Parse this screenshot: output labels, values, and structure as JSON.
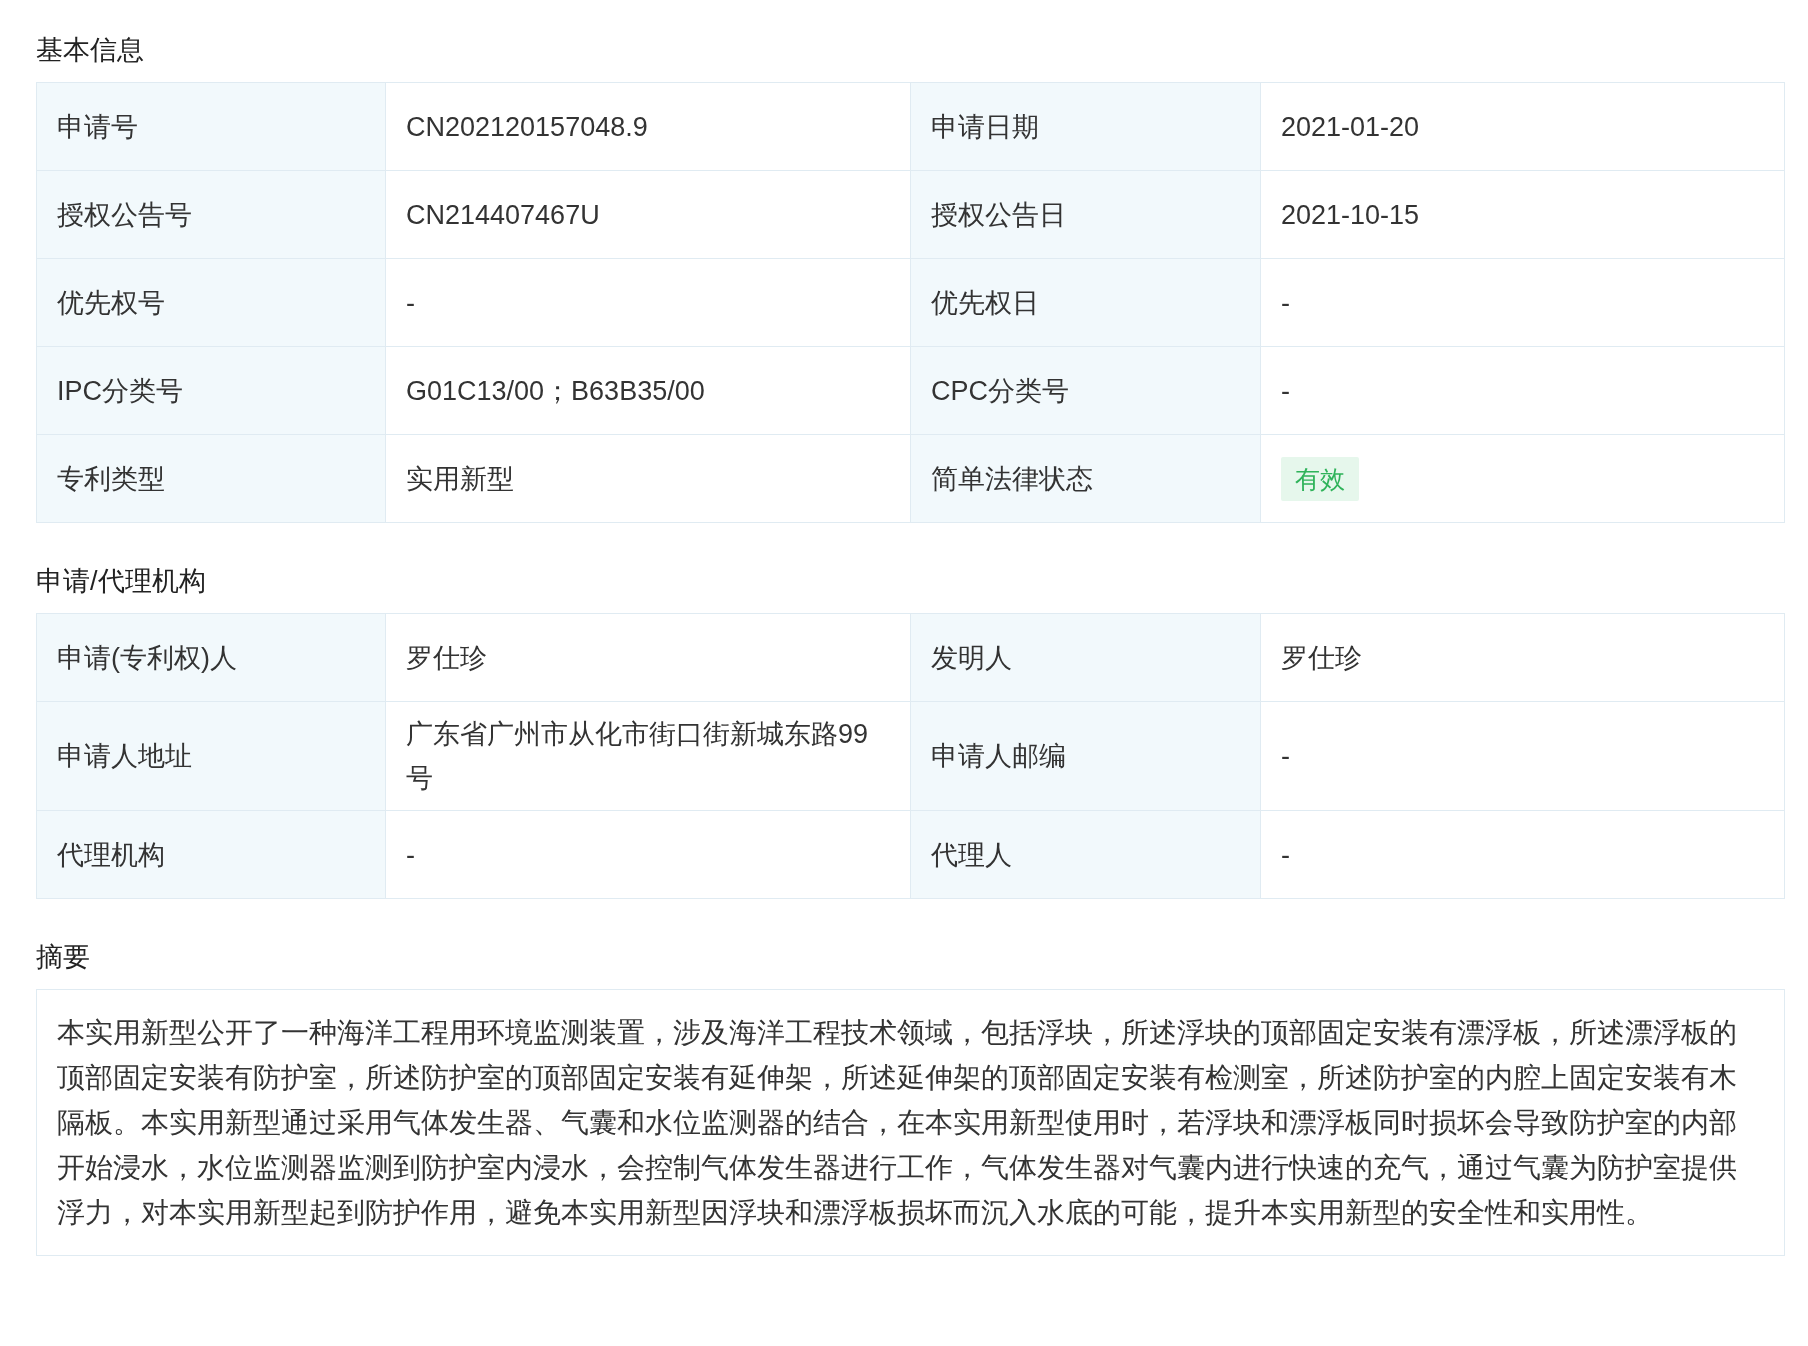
{
  "sections": [
    {
      "title": "基本信息",
      "rows": [
        [
          {
            "label": "申请号",
            "value": "CN202120157048.9",
            "kind": "text"
          },
          {
            "label": "申请日期",
            "value": "2021-01-20",
            "kind": "text"
          }
        ],
        [
          {
            "label": "授权公告号",
            "value": "CN214407467U",
            "kind": "text"
          },
          {
            "label": "授权公告日",
            "value": "2021-10-15",
            "kind": "text"
          }
        ],
        [
          {
            "label": "优先权号",
            "value": "-",
            "kind": "text"
          },
          {
            "label": "优先权日",
            "value": "-",
            "kind": "text"
          }
        ],
        [
          {
            "label": "IPC分类号",
            "value": "G01C13/00；B63B35/00",
            "kind": "text"
          },
          {
            "label": "CPC分类号",
            "value": "-",
            "kind": "text"
          }
        ],
        [
          {
            "label": "专利类型",
            "value": "实用新型",
            "kind": "text"
          },
          {
            "label": "简单法律状态",
            "value": "有效",
            "kind": "tag"
          }
        ]
      ]
    },
    {
      "title": "申请/代理机构",
      "rows": [
        [
          {
            "label": "申请(专利权)人",
            "value": "罗仕珍",
            "kind": "text"
          },
          {
            "label": "发明人",
            "value": "罗仕珍",
            "kind": "text"
          }
        ],
        [
          {
            "label": "申请人地址",
            "value": "广东省广州市从化市街口街新城东路99号",
            "kind": "text"
          },
          {
            "label": "申请人邮编",
            "value": "-",
            "kind": "text"
          }
        ],
        [
          {
            "label": "代理机构",
            "value": "-",
            "kind": "text"
          },
          {
            "label": "代理人",
            "value": "-",
            "kind": "text"
          }
        ]
      ]
    }
  ],
  "abstract": {
    "title": "摘要",
    "text": "本实用新型公开了一种海洋工程用环境监测装置，涉及海洋工程技术领域，包括浮块，所述浮块的顶部固定安装有漂浮板，所述漂浮板的顶部固定安装有防护室，所述防护室的顶部固定安装有延伸架，所述延伸架的顶部固定安装有检测室，所述防护室的内腔上固定安装有木隔板。本实用新型通过采用气体发生器、气囊和水位监测器的结合，在本实用新型使用时，若浮块和漂浮板同时损坏会导致防护室的内部开始浸水，水位监测器监测到防护室内浸水，会控制气体发生器进行工作，气体发生器对气囊内进行快速的充气，通过气囊为防护室提供浮力，对本实用新型起到防护作用，避免本实用新型因浮块和漂浮板损坏而沉入水底的可能，提升本实用新型的安全性和实用性。"
  }
}
